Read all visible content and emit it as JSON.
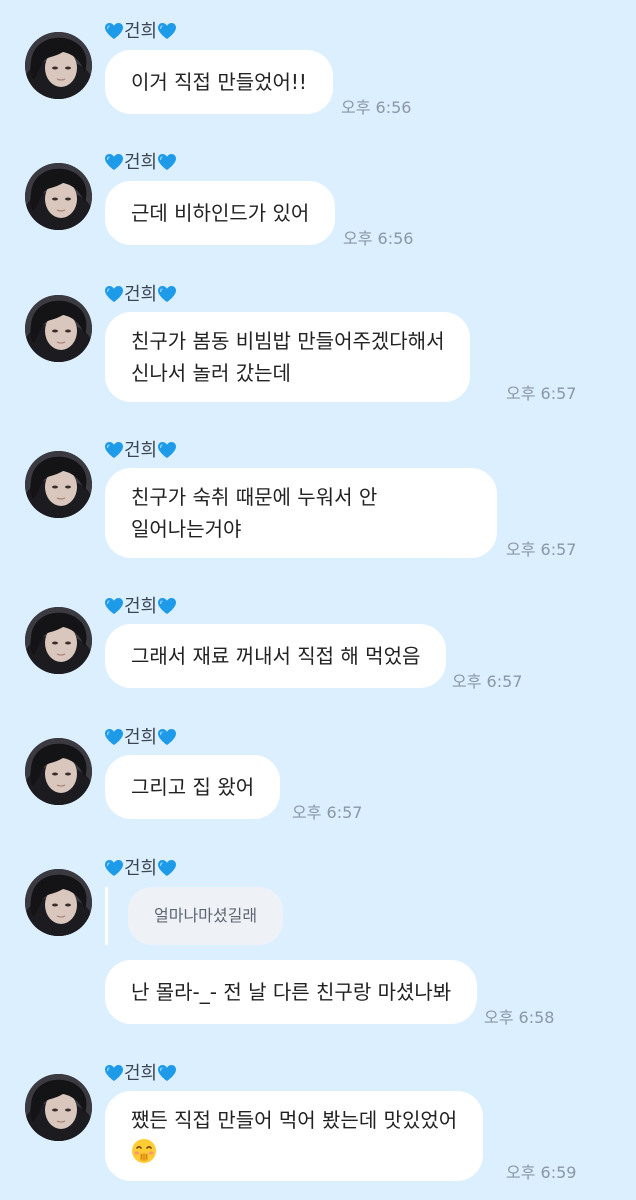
{
  "chat": {
    "messages": [
      {
        "sender": "건희",
        "text": "이거 직접 만들었어!!",
        "time": "오후 6:56"
      },
      {
        "sender": "건희",
        "text": "근데 비하인드가 있어",
        "time": "오후 6:56"
      },
      {
        "sender": "건희",
        "line1": "친구가 봄동 비빔밥 만들어주겠다해서",
        "line2": "신나서 놀러 갔는데",
        "time": "오후 6:57"
      },
      {
        "sender": "건희",
        "line1": "친구가 숙취 때문에 누워서 안",
        "line2": "일어나는거야",
        "time": "오후 6:57"
      },
      {
        "sender": "건희",
        "text": "그래서 재료 꺼내서 직접 해 먹었음",
        "time": "오후 6:57"
      },
      {
        "sender": "건희",
        "text": "그리고 집 왔어",
        "time": "오후 6:57"
      },
      {
        "sender": "건희",
        "reply_to": "얼마나마셨길래",
        "text": "난 몰라-_- 전 날 다른 친구랑 마셨나봐",
        "time": "오후 6:58"
      },
      {
        "sender": "건희",
        "line1": "쨌든 직접 만들어 먹어 봤는데 맛있었어",
        "emoji": "laughing-with-hand-over-mouth",
        "time": "오후 6:59"
      }
    ]
  },
  "colors": {
    "background": "#dcefff",
    "bubble": "#ffffff",
    "heart": "#1e9be8",
    "timestamp": "#8b97a3"
  },
  "icons": {
    "heart": "blue-heart-icon",
    "avatar": "profile-photo"
  }
}
